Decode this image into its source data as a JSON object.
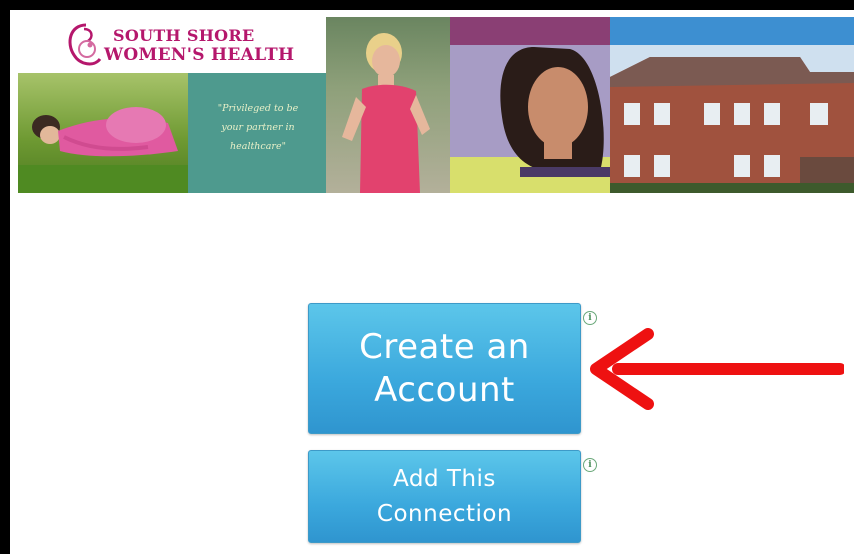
{
  "banner": {
    "logo_line1": "SOUTH SHORE",
    "logo_line2": "WOMEN'S HEALTH",
    "tagline": "\"Privileged to be\nyour partner in\nhealthcare\"",
    "colors": {
      "brand": "#b5176c",
      "teal": "#4e9a8e",
      "purple": "#8a3f74",
      "lavender": "#a79cc5",
      "lime": "#d8df6c",
      "blue": "#3d8fd1"
    }
  },
  "buttons": {
    "create_account": "Create an\nAccount",
    "add_connection": "Add This\nConnection",
    "info_glyph": "i"
  },
  "annotation": {
    "arrow_color": "#ee1111"
  }
}
